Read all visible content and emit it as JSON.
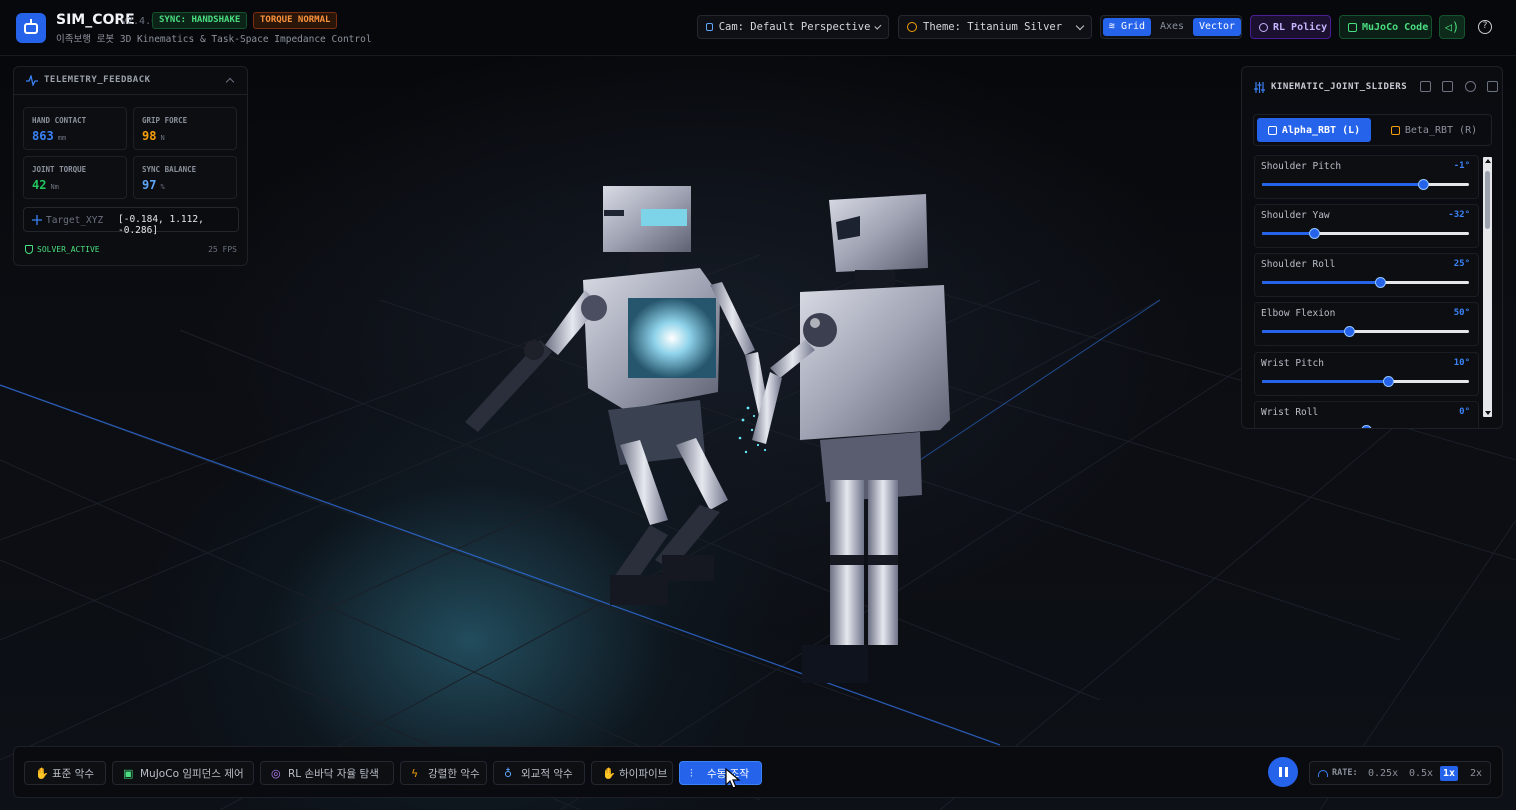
{
  "header": {
    "app_name": "SIM_CORE",
    "version": "v2.4.0",
    "badge_sync": "SYNC: HANDSHAKE",
    "badge_torque": "TORQUE NORMAL",
    "subtitle": "이족보행 로봇 3D Kinematics & Task-Space Impedance Control",
    "camera_select": "Cam: Default Perspective",
    "theme_select": "Theme: Titanium Silver",
    "view_toggles": {
      "grid": "Grid",
      "axes": "Axes",
      "vector": "Vector"
    },
    "rl_policy": "RL Policy",
    "mujoco_code": "MuJoCo Code",
    "help": "?"
  },
  "telemetry": {
    "title": "TELEMETRY_FEEDBACK",
    "stats": [
      {
        "label": "HAND CONTACT",
        "value": "863",
        "unit": "mm",
        "color": "#3b82f6"
      },
      {
        "label": "GRIP FORCE",
        "value": "98",
        "unit": "N",
        "color": "#f59e0b"
      },
      {
        "label": "JOINT TORQUE",
        "value": "42",
        "unit": "Nm",
        "color": "#22c55e"
      },
      {
        "label": "SYNC BALANCE",
        "value": "97",
        "unit": "%",
        "color": "#60a5fa"
      }
    ],
    "target_label": "Target_XYZ",
    "target_value": "[-0.184, 1.112, -0.286]",
    "solver_status": "SOLVER_ACTIVE",
    "fps": "25 FPS"
  },
  "joints": {
    "title": "KINEMATIC_JOINT_SLIDERS",
    "tabs": {
      "alpha": "Alpha_RBT (L)",
      "beta": "Beta_RBT (R)"
    },
    "sliders": [
      {
        "name": "Shoulder Pitch",
        "value": "-1°",
        "fraction": 0.78
      },
      {
        "name": "Shoulder Yaw",
        "value": "-32°",
        "fraction": 0.25
      },
      {
        "name": "Shoulder Roll",
        "value": "25°",
        "fraction": 0.57
      },
      {
        "name": "Elbow Flexion",
        "value": "50°",
        "fraction": 0.42
      },
      {
        "name": "Wrist Pitch",
        "value": "10°",
        "fraction": 0.61
      },
      {
        "name": "Wrist Roll",
        "value": "0°",
        "fraction": 0.5
      }
    ]
  },
  "bottom": {
    "modes": [
      {
        "label": "표준 악수",
        "icon": "hand-icon",
        "active": false
      },
      {
        "label": "MuJoCo 임피던스 제어",
        "icon": "cpu-icon",
        "active": false
      },
      {
        "label": "RL 손바닥 자율 탐색",
        "icon": "brain-icon",
        "active": false
      },
      {
        "label": "강렬한 악수",
        "icon": "lightning-icon",
        "active": false
      },
      {
        "label": "외교적 악수",
        "icon": "award-icon",
        "active": false
      },
      {
        "label": "하이파이브",
        "icon": "hand-icon",
        "active": false
      },
      {
        "label": "수동 조작",
        "icon": "sliders-icon",
        "active": true
      }
    ],
    "rate_label": "RATE:",
    "rates": [
      "0.25x",
      "0.5x",
      "1x",
      "2x"
    ],
    "selected_rate": "1x"
  },
  "colors": {
    "accent": "#2563eb",
    "success": "#4ade80",
    "warning": "#fb923c",
    "rl": "#c4b5fd"
  }
}
